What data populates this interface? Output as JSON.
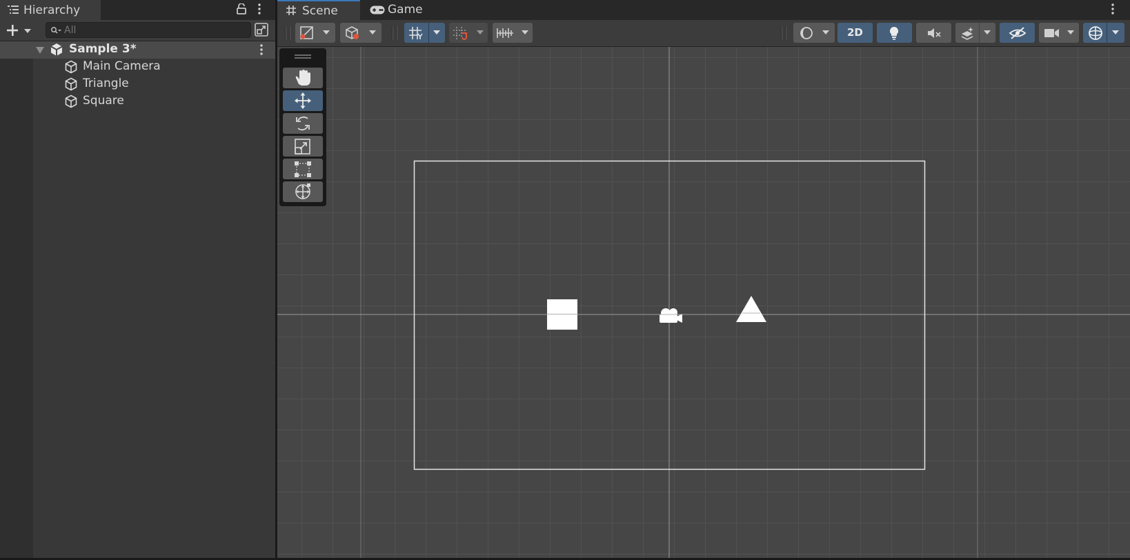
{
  "hierarchy": {
    "tab_label": "Hierarchy",
    "search": {
      "placeholder": "All",
      "value": ""
    },
    "scene": {
      "name": "Sample 3*"
    },
    "items": [
      {
        "label": "Main Camera",
        "icon": "gameobject-cube-icon"
      },
      {
        "label": "Triangle",
        "icon": "gameobject-cube-icon"
      },
      {
        "label": "Square",
        "icon": "gameobject-cube-icon"
      }
    ]
  },
  "scene_view": {
    "tabs": [
      {
        "label": "Scene",
        "icon": "grid-hash-icon",
        "active": true
      },
      {
        "label": "Game",
        "icon": "gamepad-icon",
        "active": false
      }
    ],
    "toolbar": {
      "mode_2d_label": "2D",
      "active_toggles": [
        "grid-snap",
        "2d",
        "lighting",
        "scene-visibility",
        "gizmos"
      ]
    },
    "tools": [
      "hand",
      "move",
      "rotate",
      "scale",
      "rect",
      "transform"
    ],
    "active_tool": "move",
    "objects": [
      {
        "name": "Square",
        "shape": "square",
        "color": "#ffffff"
      },
      {
        "name": "Main Camera",
        "shape": "camera-gizmo",
        "color": "#ffffff"
      },
      {
        "name": "Triangle",
        "shape": "triangle",
        "color": "#ffffff"
      }
    ]
  },
  "colors": {
    "accent": "#46607c",
    "tab_highlight": "#3a79bb",
    "panel_bg": "#383838",
    "viewport_bg": "#464646"
  }
}
